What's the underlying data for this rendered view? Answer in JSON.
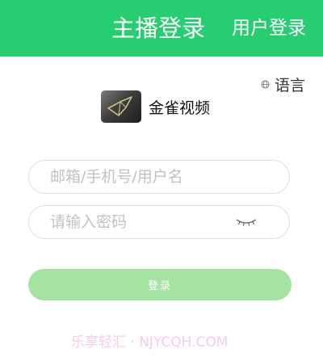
{
  "header": {
    "tab_host": "主播登录",
    "tab_user": "用户登录",
    "color": "#27cd71"
  },
  "language": {
    "label": "语言",
    "icon": "globe-icon"
  },
  "brand": {
    "name": "金雀视频",
    "logo": "sparrow-logo"
  },
  "form": {
    "account_placeholder": "邮箱/手机号/用户名",
    "password_placeholder": "请输入密码",
    "password_toggle_icon": "eye-closed-icon",
    "login_label": "登录",
    "login_color": "#a5e3a2"
  },
  "watermark": "乐享轻汇 · NJYCQH.COM"
}
